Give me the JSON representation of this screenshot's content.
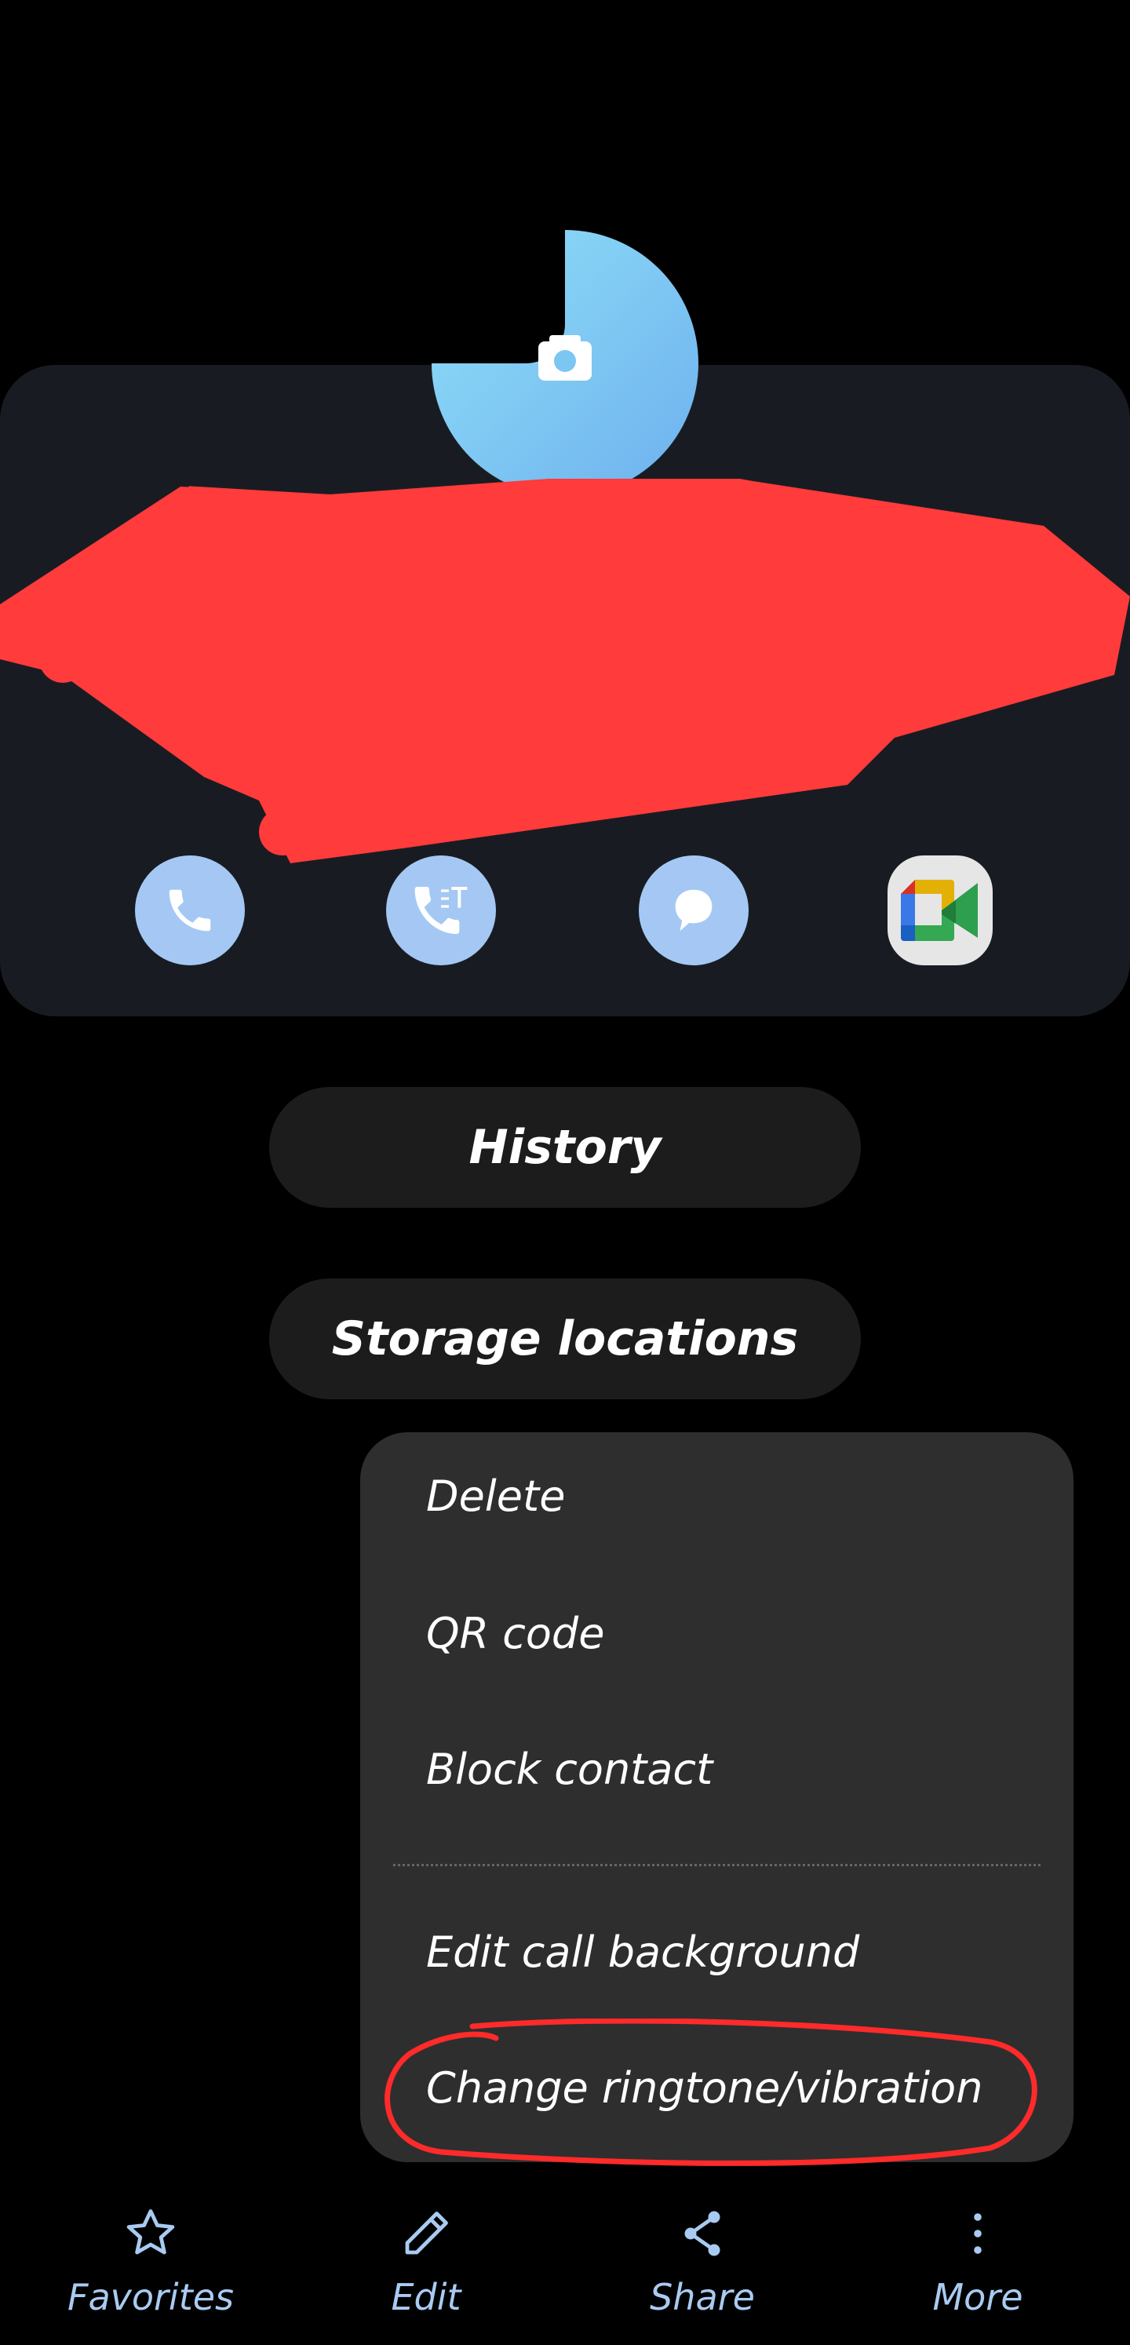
{
  "contact": {
    "avatar_icon": "camera-icon",
    "name_redacted": true,
    "actions": [
      {
        "name": "call",
        "icon": "phone-icon"
      },
      {
        "name": "rtt-call",
        "icon": "phone-text-icon"
      },
      {
        "name": "message",
        "icon": "message-icon"
      },
      {
        "name": "google-meet",
        "icon": "google-meet-icon"
      }
    ]
  },
  "buttons": {
    "history": "History",
    "storage": "Storage locations"
  },
  "menu": {
    "items": [
      "Delete",
      "QR code",
      "Block contact",
      "Edit call background",
      "Change ringtone/vibration"
    ],
    "highlight_color": "#ff2a2a"
  },
  "bottom_nav": [
    {
      "label": "Favorites",
      "icon": "star-icon"
    },
    {
      "label": "Edit",
      "icon": "pencil-icon"
    },
    {
      "label": "Share",
      "icon": "share-icon"
    },
    {
      "label": "More",
      "icon": "more-vertical-icon"
    }
  ],
  "colors": {
    "accent": "#a4c8f3",
    "redaction": "#ff3b3b"
  }
}
